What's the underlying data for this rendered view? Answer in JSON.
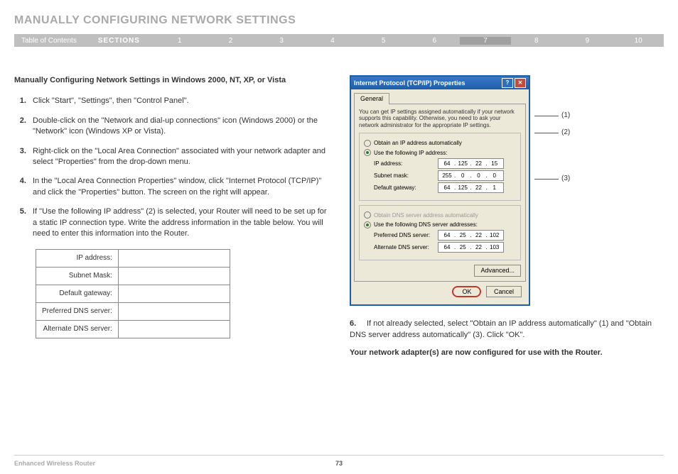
{
  "header": {
    "title": "MANUALLY CONFIGURING NETWORK SETTINGS",
    "toc": "Table of Contents",
    "sections_label": "SECTIONS",
    "sections": [
      "1",
      "2",
      "3",
      "4",
      "5",
      "6",
      "7",
      "8",
      "9",
      "10"
    ],
    "active": "7"
  },
  "subheading": "Manually Configuring Network Settings in Windows 2000, NT, XP, or Vista",
  "steps": [
    "Click \"Start\", \"Settings\", then \"Control Panel\".",
    "Double-click on the \"Network and dial-up connections\" icon (Windows 2000) or the \"Network\" icon (Windows XP or Vista).",
    "Right-click on the \"Local Area Connection\" associated with your network adapter and select \"Properties\" from the drop-down menu.",
    "In the \"Local Area Connection Properties\" window, click \"Internet Protocol (TCP/IP)\" and click the \"Properties\" button. The screen on the right will appear.",
    "If \"Use the following IP address\" (2) is selected, your Router will need to be set up for a static IP connection type. Write the address information in the table below. You will need to enter this information into the Router."
  ],
  "addr_table": {
    "rows": [
      "IP address:",
      "Subnet Mask:",
      "Default gateway:",
      "Preferred DNS server:",
      "Alternate DNS server:"
    ]
  },
  "dialog": {
    "title": "Internet Protocol (TCP/IP) Properties",
    "help": "?",
    "close": "✕",
    "tab": "General",
    "desc": "You can get IP settings assigned automatically if your network supports this capability. Otherwise, you need to ask your network administrator for the appropriate IP settings.",
    "r_auto_ip": "Obtain an IP address automatically",
    "r_use_ip": "Use the following IP address:",
    "ip_label": "IP address:",
    "ip": [
      "64",
      "125",
      "22",
      "15"
    ],
    "sm_label": "Subnet mask:",
    "sm": [
      "255",
      "0",
      "0",
      "0"
    ],
    "gw_label": "Default gateway:",
    "gw": [
      "64",
      "125",
      "22",
      "1"
    ],
    "r_auto_dns": "Obtain DNS server address automatically",
    "r_use_dns": "Use the following DNS server addresses:",
    "pd_label": "Preferred DNS server:",
    "pd": [
      "64",
      "25",
      "22",
      "102"
    ],
    "ad_label": "Alternate DNS server:",
    "ad": [
      "64",
      "25",
      "22",
      "103"
    ],
    "advanced": "Advanced...",
    "ok": "OK",
    "cancel": "Cancel"
  },
  "callouts": {
    "c1": "(1)",
    "c2": "(2)",
    "c3": "(3)"
  },
  "step6_num": "6.",
  "step6": "If not already selected, select \"Obtain an IP address automatically\" (1) and \"Obtain DNS server address automatically\" (3). Click \"OK\".",
  "final": "Your network adapter(s) are now configured for use with the Router.",
  "footer": {
    "product": "Enhanced Wireless Router",
    "page": "73"
  }
}
